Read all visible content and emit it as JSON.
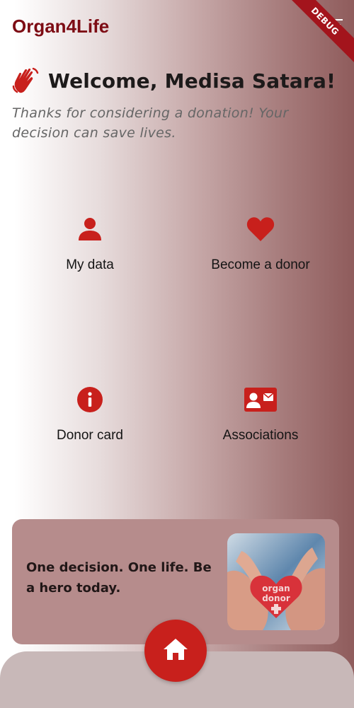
{
  "appbar": {
    "title": "Organ4Life",
    "debug_label": "DEBUG"
  },
  "welcome": {
    "title": "Welcome, Medisa Satara!",
    "subtitle": "Thanks for considering a donation! Your decision can save lives."
  },
  "menu": [
    {
      "label": "My data",
      "icon": "person-icon"
    },
    {
      "label": "Become a donor",
      "icon": "heart-icon"
    },
    {
      "label": "Donor card",
      "icon": "info-icon"
    },
    {
      "label": "Associations",
      "icon": "contact-card-icon"
    }
  ],
  "promo": {
    "text": "One decision. One life. Be a hero today.",
    "image_text_line1": "organ",
    "image_text_line2": "donor"
  },
  "bottom_nav": {
    "icon": "home-icon"
  },
  "colors": {
    "accent": "#c8201c",
    "brand_dark": "#7d0c14",
    "card": "#b68c8c",
    "nav": "#c8b8b8"
  }
}
